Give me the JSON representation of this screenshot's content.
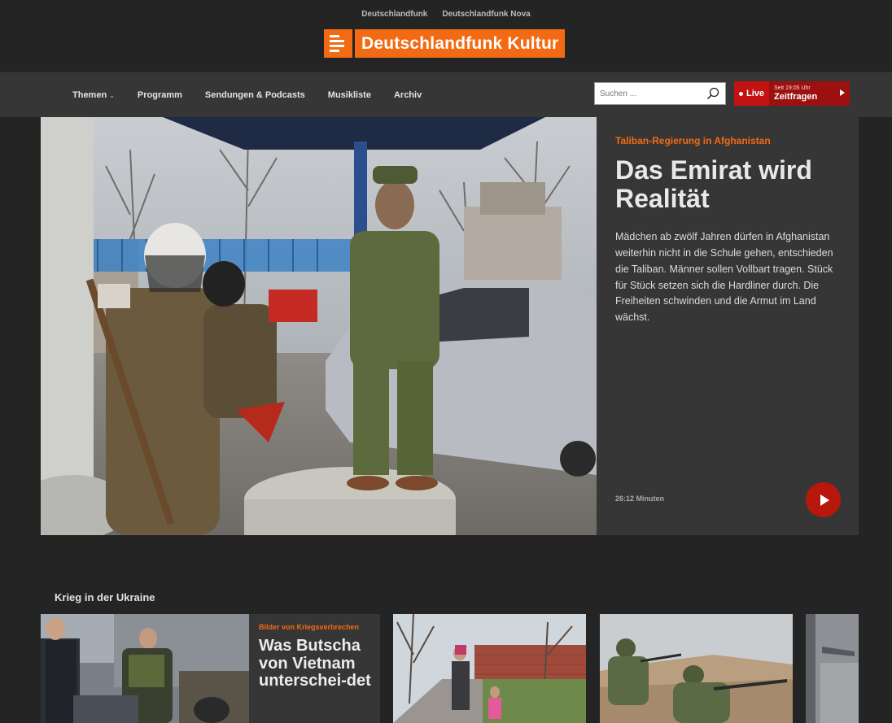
{
  "sister_links": [
    "Deutschlandfunk",
    "Deutschlandfunk Nova"
  ],
  "logo_text": "Deutschlandfunk Kultur",
  "nav": {
    "items": [
      "Themen",
      "Programm",
      "Sendungen & Podcasts",
      "Musikliste",
      "Archiv"
    ]
  },
  "search": {
    "placeholder": "Suchen ..."
  },
  "live": {
    "label": "Live",
    "time": "Seit 19:05 Uhr",
    "show": "Zeitfragen"
  },
  "hero": {
    "kicker": "Taliban-Regierung in Afghanistan",
    "headline": "Das Emirat wird Realität",
    "teaser": "Mädchen ab zwölf Jahren dürfen in Afghanistan weiterhin nicht in die Schule gehen, entschieden die Taliban. Männer sollen Vollbart tragen. Stück für Stück setzen sich die Hardliner durch. Die Freiheiten schwinden und die Armut im Land wächst.",
    "duration": "26:12 Minuten"
  },
  "section": {
    "title": "Krieg in der Ukraine",
    "card1": {
      "kicker": "Bilder von Kriegsverbrechen",
      "title": "Was Butscha von Vietnam unterschei-det"
    }
  },
  "colors": {
    "accent": "#f26a13",
    "live_red": "#c41212",
    "play_red": "#b8180c",
    "background": "#242424",
    "panel": "#363636"
  },
  "icons": [
    "search-icon",
    "chevron-down-icon",
    "play-icon",
    "live-dot-icon",
    "arrow-right-icon",
    "logo-icon"
  ]
}
